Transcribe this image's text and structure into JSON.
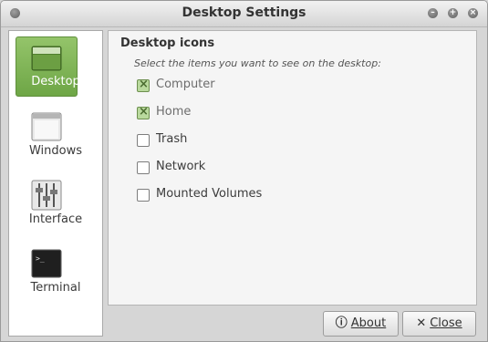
{
  "window": {
    "title": "Desktop Settings"
  },
  "sidebar": {
    "items": [
      {
        "label": "Desktop",
        "icon": "desktop-icon",
        "selected": true
      },
      {
        "label": "Windows",
        "icon": "windows-icon",
        "selected": false
      },
      {
        "label": "Interface",
        "icon": "interface-icon",
        "selected": false
      },
      {
        "label": "Terminal",
        "icon": "terminal-icon",
        "selected": false
      }
    ]
  },
  "main": {
    "section_title": "Desktop icons",
    "hint": "Select the items you want to see on the desktop:",
    "options": [
      {
        "label": "Computer",
        "checked": true
      },
      {
        "label": "Home",
        "checked": true
      },
      {
        "label": "Trash",
        "checked": false
      },
      {
        "label": "Network",
        "checked": false
      },
      {
        "label": "Mounted Volumes",
        "checked": false
      }
    ]
  },
  "buttons": {
    "about_label": "About",
    "close_label": "Close"
  },
  "colors": {
    "accent_green": "#7fb356",
    "window_bg": "#d6d6d6",
    "panel_bg": "#f5f5f5"
  }
}
